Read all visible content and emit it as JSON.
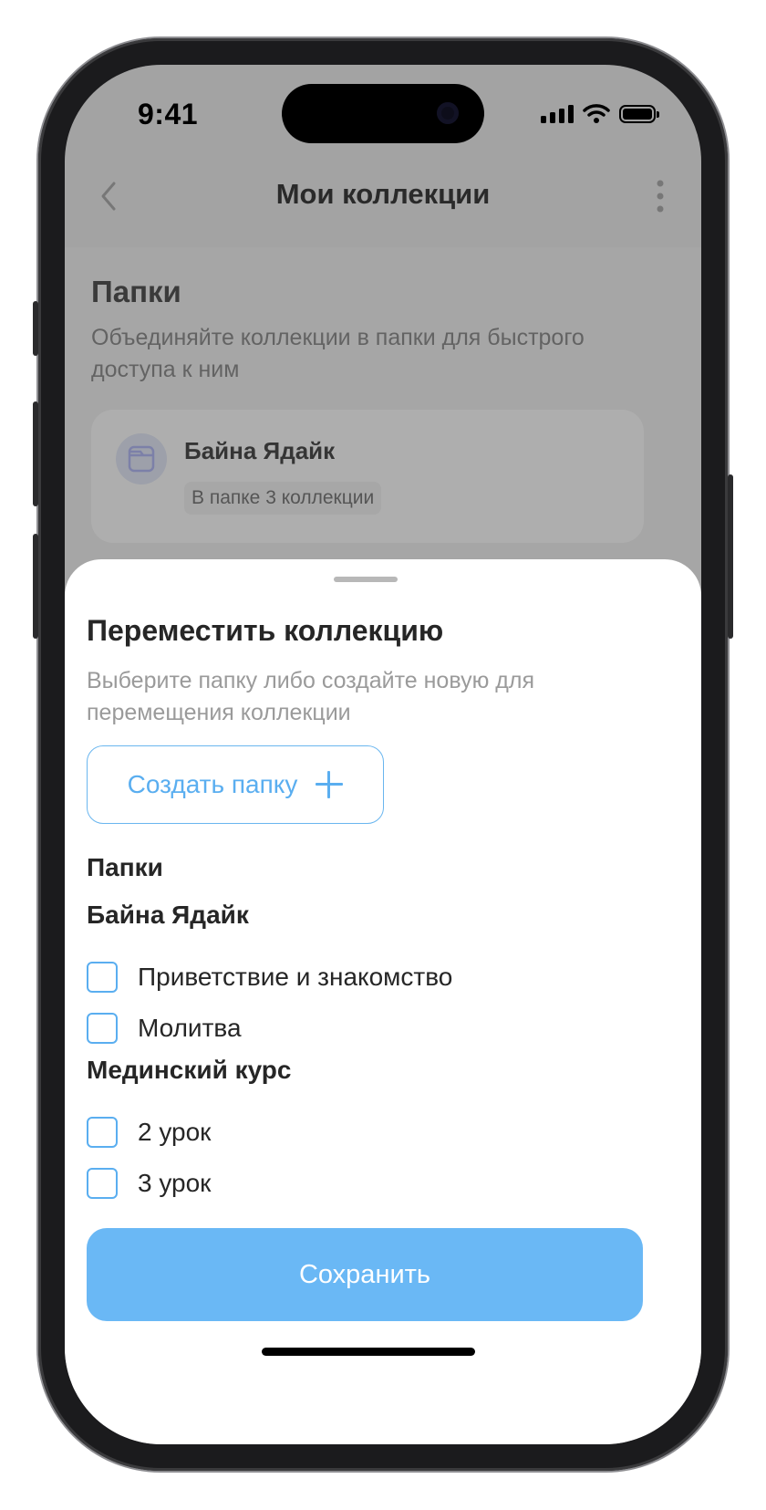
{
  "status": {
    "time": "9:41"
  },
  "nav": {
    "title": "Мои коллекции"
  },
  "folders_section": {
    "title": "Папки",
    "subtitle": "Объединяйте коллекции в папки для быстрого доступа к ним",
    "card": {
      "name": "Байна Ядайк",
      "badge": "В папке 3 коллекции"
    }
  },
  "sheet": {
    "title": "Переместить коллекцию",
    "subtitle": "Выберите папку либо создайте новую для перемещения коллекции",
    "create_label": "Создать папку",
    "folders_heading": "Папки",
    "groups": [
      {
        "title": "Байна Ядайк",
        "items": [
          {
            "label": "Приветствие и знакомство",
            "checked": false
          },
          {
            "label": "Молитва",
            "checked": false
          }
        ]
      },
      {
        "title": "Мединский курс",
        "items": [
          {
            "label": "2 урок",
            "checked": false
          },
          {
            "label": "3 урок",
            "checked": false
          }
        ]
      }
    ],
    "save_label": "Сохранить"
  },
  "colors": {
    "accent": "#5aaef0",
    "save_button": "#6ab8f5",
    "dim_overlay": "#a3a3a3"
  },
  "icons": [
    "back-chevron-icon",
    "more-vertical-icon",
    "folder-icon",
    "plus-icon",
    "signal-icon",
    "wifi-icon",
    "battery-icon"
  ]
}
